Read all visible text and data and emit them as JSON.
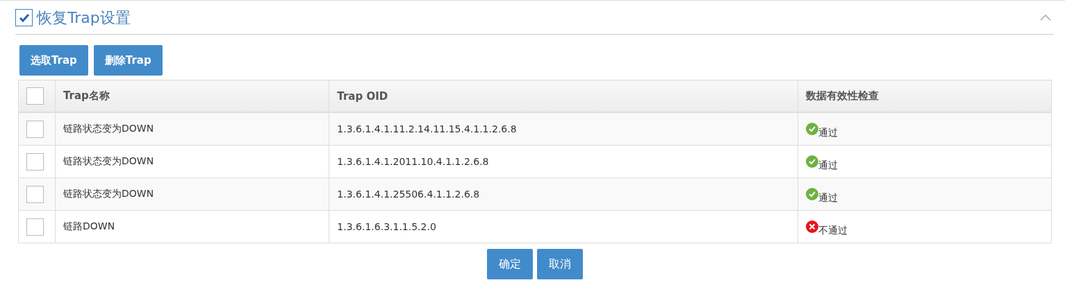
{
  "section": {
    "title": "恢复Trap设置",
    "checked": true,
    "expanded": true
  },
  "toolbar": [
    "选取Trap",
    "删除Trap"
  ],
  "table": {
    "select_all": {
      "checked": false
    },
    "columns": [
      "Trap名称",
      "Trap OID",
      "数据有效性检查"
    ],
    "rows": [
      {
        "checked": false,
        "name": "链路状态变为DOWN",
        "oid": "1.3.6.1.4.1.11.2.14.11.15.4.1.1.2.6.8",
        "check": {
          "kind": "pass",
          "text": "通过"
        }
      },
      {
        "checked": false,
        "name": "链路状态变为DOWN",
        "oid": "1.3.6.1.4.1.2011.10.4.1.1.2.6.8",
        "check": {
          "kind": "pass",
          "text": "通过"
        }
      },
      {
        "checked": false,
        "name": "链路状态变为DOWN",
        "oid": "1.3.6.1.4.1.25506.4.1.1.2.6.8",
        "check": {
          "kind": "pass",
          "text": "通过"
        }
      },
      {
        "checked": false,
        "name": "链路DOWN",
        "oid": "1.3.6.1.6.3.1.1.5.2.0",
        "check": {
          "kind": "fail",
          "text": "不通过"
        }
      }
    ]
  },
  "buttons": [
    "确定",
    "取消"
  ]
}
